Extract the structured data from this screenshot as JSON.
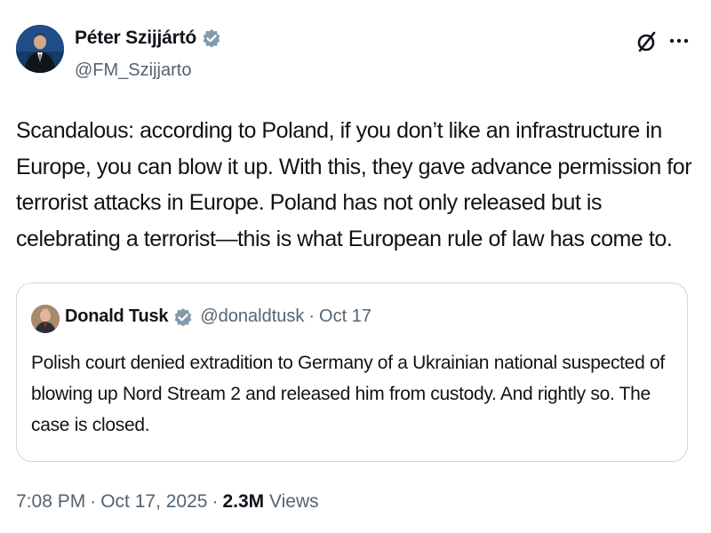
{
  "author": {
    "name": "Péter Szijjártó",
    "handle": "@FM_Szijjarto",
    "verified_color": "#829aab"
  },
  "tweet": {
    "text": "Scandalous: according to Poland, if you don’t like an infrastructure in Europe, you can blow it up. With this, they gave advance permission for terrorist attacks in Europe. Poland has not only released but is celebrating a terrorist—this is what European rule of law has come to."
  },
  "quote": {
    "name": "Donald Tusk",
    "handle": "@donaldtusk",
    "separator": "·",
    "date": "Oct 17",
    "text": "Polish court denied extradition to Germany of a Ukrainian national suspected of blowing up Nord Stream 2 and released him from custody. And rightly so. The case is closed."
  },
  "meta": {
    "time": "7:08 PM",
    "separator": "·",
    "date": "Oct 17, 2025",
    "views_count": "2.3M",
    "views_label": "Views"
  },
  "icons": {
    "grok": "grok-icon",
    "more": "more-icon",
    "verified": "verified-badge-icon"
  }
}
